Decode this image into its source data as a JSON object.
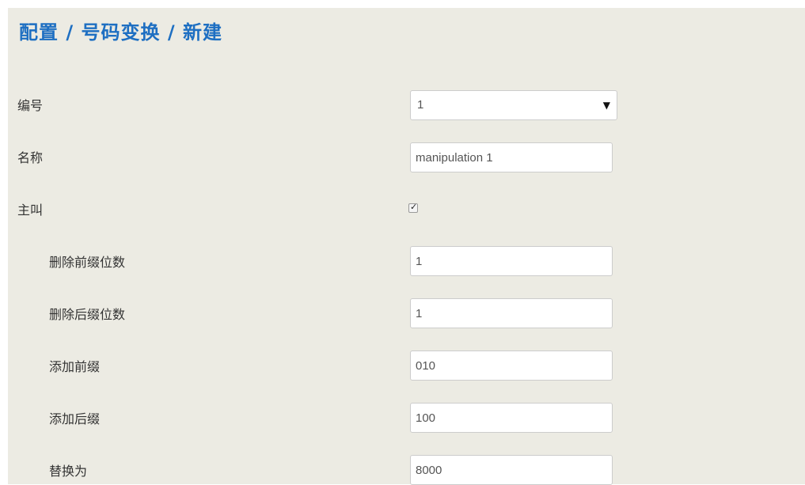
{
  "header": {
    "breadcrumb_title": "配置 / 号码变换 / 新建"
  },
  "form": {
    "number": {
      "label": "编号",
      "value": "1"
    },
    "name": {
      "label": "名称",
      "value": "manipulation 1"
    },
    "calling": {
      "label": "主叫",
      "checked": true
    },
    "delete_prefix_digits": {
      "label": "删除前缀位数",
      "value": "1"
    },
    "delete_suffix_digits": {
      "label": "删除后缀位数",
      "value": "1"
    },
    "add_prefix": {
      "label": "添加前缀",
      "value": "010"
    },
    "add_suffix": {
      "label": "添加后缀",
      "value": "100"
    },
    "replace_with": {
      "label": "替换为",
      "value": "8000"
    }
  },
  "icons": {
    "select_caret": "caret-down-icon",
    "checkbox_mark": "checkmark-icon"
  },
  "colors": {
    "title": "#1e6fc2",
    "panel_background": "#ecebe3"
  }
}
